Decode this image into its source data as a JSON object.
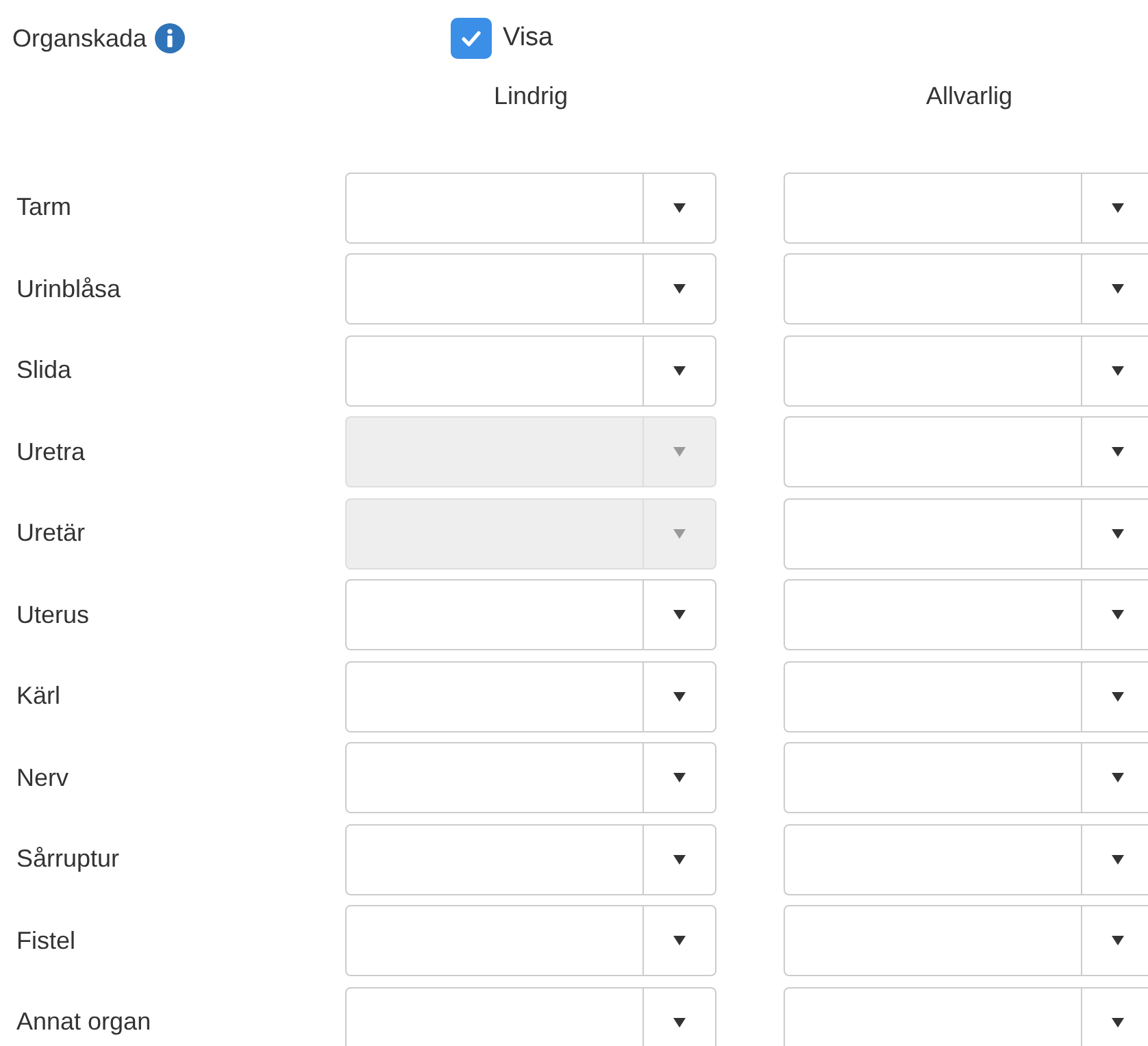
{
  "section": {
    "title": "Organskada",
    "show_checkbox": {
      "label": "Visa",
      "checked": true
    }
  },
  "columns": [
    "Lindrig",
    "Allvarlig"
  ],
  "rows": [
    {
      "label": "Tarm",
      "fields": [
        {
          "disabled": false
        },
        {
          "disabled": false
        }
      ]
    },
    {
      "label": "Urinblåsa",
      "fields": [
        {
          "disabled": false
        },
        {
          "disabled": false
        }
      ]
    },
    {
      "label": "Slida",
      "fields": [
        {
          "disabled": false
        },
        {
          "disabled": false
        }
      ]
    },
    {
      "label": "Uretra",
      "fields": [
        {
          "disabled": true
        },
        {
          "disabled": false
        }
      ]
    },
    {
      "label": "Uretär",
      "fields": [
        {
          "disabled": true
        },
        {
          "disabled": false
        }
      ]
    },
    {
      "label": "Uterus",
      "fields": [
        {
          "disabled": false
        },
        {
          "disabled": false
        }
      ]
    },
    {
      "label": "Kärl",
      "fields": [
        {
          "disabled": false
        },
        {
          "disabled": false
        }
      ]
    },
    {
      "label": "Nerv",
      "fields": [
        {
          "disabled": false
        },
        {
          "disabled": false
        }
      ]
    },
    {
      "label": "Sårruptur",
      "fields": [
        {
          "disabled": false
        },
        {
          "disabled": false
        }
      ]
    },
    {
      "label": "Fistel",
      "fields": [
        {
          "disabled": false
        },
        {
          "disabled": false
        }
      ]
    },
    {
      "label": "Annat organ",
      "fields": [
        {
          "disabled": false
        },
        {
          "disabled": false
        }
      ]
    }
  ]
}
